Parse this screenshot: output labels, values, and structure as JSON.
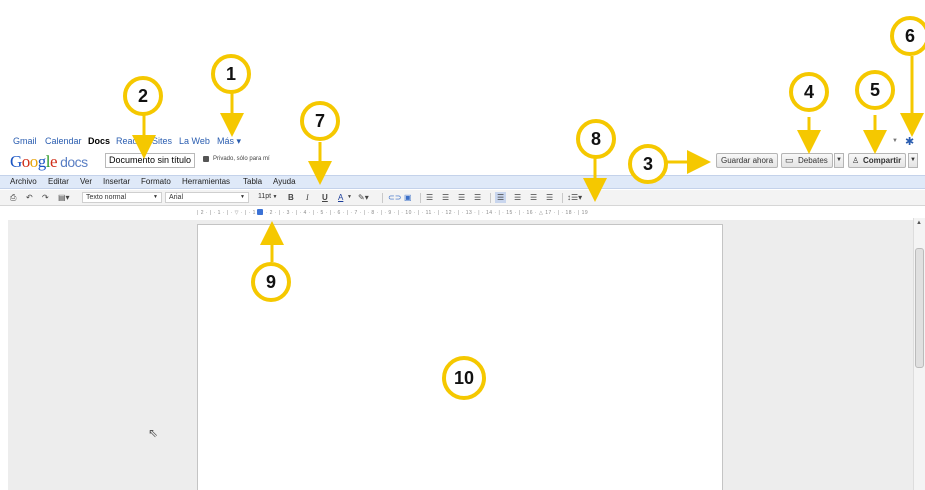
{
  "gbar": {
    "links": [
      "Gmail",
      "Calendar",
      "Docs",
      "Reader",
      "Sites",
      "La Web",
      "Más ▾"
    ]
  },
  "header": {
    "logo_text": "Google",
    "logo_suffix": "docs",
    "doc_title": "Documento sin título",
    "privacy": "Privado, sólo para mí",
    "save_now": "Guardar ahora",
    "discussions": "Debates",
    "share": "Compartir"
  },
  "menu": [
    "Archivo",
    "Editar",
    "Ver",
    "Insertar",
    "Formato",
    "Herramientas",
    "Tabla",
    "Ayuda"
  ],
  "toolbar": {
    "style": "Texto normal",
    "font": "Arial",
    "size": "11pt",
    "bold": "B",
    "italic": "I",
    "underline": "U",
    "textcolor": "A"
  },
  "ruler": "| 2 · | · 1 · | · ▽ · | · 1 · | · 2 · | · 3 · | · 4 · | · 5 · | · 6 · | · 7 · | · 8 · | · 9 · | · 10 · | · 11 · | · 12 · | · 13 · | · 14 · | · 15 · | · 16 · △ 17 · | · 18 · | 19",
  "callouts": [
    "1",
    "2",
    "3",
    "4",
    "5",
    "6",
    "7",
    "8",
    "9",
    "10"
  ],
  "colors": {
    "callout_ring": "#f5c800",
    "menubar": "#dfe9f8",
    "link": "#2a5db0"
  },
  "icons": [
    "print-icon",
    "undo-icon",
    "redo-icon",
    "paint-format-icon",
    "link-icon",
    "image-icon",
    "numbered-list-icon",
    "bullet-list-icon",
    "align-left-icon",
    "gear-icon",
    "discussion-icon",
    "share-lock-icon"
  ]
}
